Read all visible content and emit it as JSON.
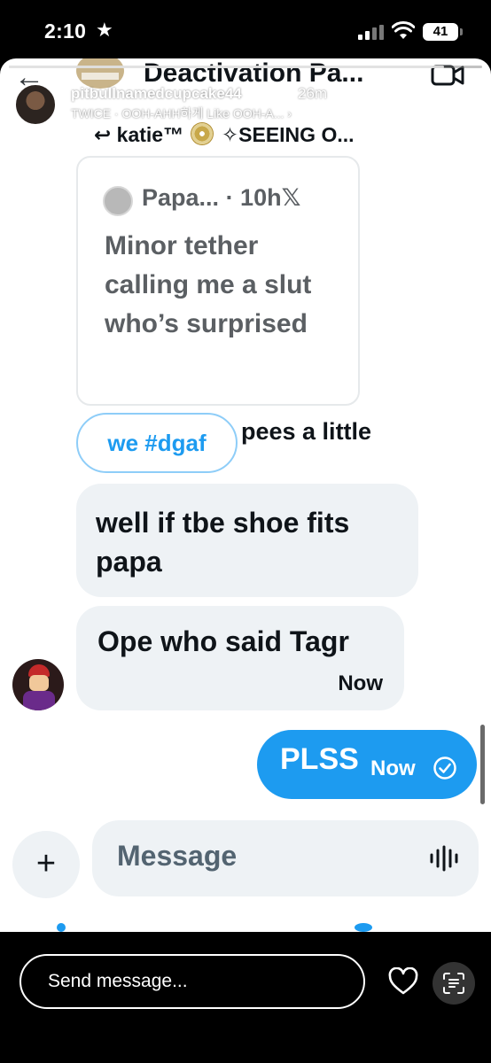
{
  "status_bar": {
    "time": "2:10",
    "battery": "41"
  },
  "dm_header": {
    "title": "Deactivation Pa..."
  },
  "story": {
    "username": "pitbullnamedcupcake44",
    "time_ago": "26m",
    "music": "TWICE · OOH-AHH하게 Like OOH-A... ›",
    "progress": 0.92
  },
  "chat": {
    "reply_context_prefix": "↩ katie™",
    "reply_context_suffix": "✧SEEING O...",
    "quoted_tweet": {
      "author": "Papa...",
      "time": "· 10h",
      "logo": "𝕏",
      "text": "Minor tether calling me a slut who’s surprised"
    },
    "reaction_pill": "we #dgaf",
    "reaction_text": "pees a little",
    "messages_received": [
      {
        "text": "well if tbe shoe fits papa"
      },
      {
        "text": "Ope who said Tagr",
        "time": "Now"
      }
    ],
    "message_sent": {
      "text": "PLSS",
      "time": "Now"
    }
  },
  "composer": {
    "add_label": "+",
    "placeholder": "Message"
  },
  "bottom_bar": {
    "send_placeholder": "Send message..."
  }
}
